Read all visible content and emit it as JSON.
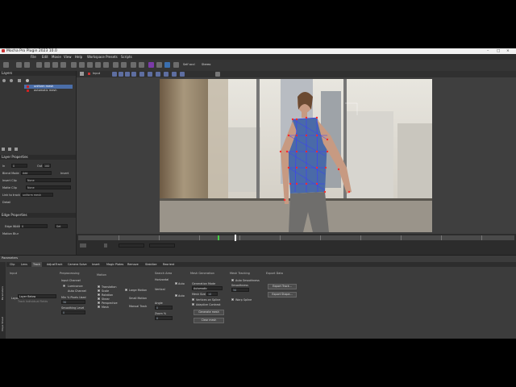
{
  "window": {
    "title": "Mocha Pro Plugin 2023 10.0"
  },
  "menu": [
    "File",
    "Edit",
    "Movie",
    "View",
    "Help",
    "Workspace Presets",
    "Scripts"
  ],
  "toolbar": {
    "layer_dropdown": "Input",
    "self_occlusion": "Self occl",
    "mode_dropdown": "Stereo"
  },
  "layers": {
    "header": "Layers",
    "items": [
      {
        "label": "uniform mesh",
        "color": "#cc2222"
      },
      {
        "label": "automatic mesh",
        "color": "#cc2222"
      }
    ]
  },
  "layer_properties": {
    "header": "Layer Properties",
    "rows": [
      {
        "label": "In",
        "value": "0"
      },
      {
        "label": "Blend Mode",
        "value": "Add"
      },
      {
        "label": "Insert Clip",
        "value": "None"
      },
      {
        "label": "Matte Clip",
        "value": "None"
      },
      {
        "label": "Link to track",
        "value": "uniform mesh"
      },
      {
        "label": "Detail",
        "value": ""
      }
    ],
    "out_label": "Out",
    "out_value": "100",
    "invert_label": "Invert"
  },
  "edge_properties": {
    "header": "Edge Properties",
    "edge_width_label": "Edge Width",
    "edge_width_value": "0",
    "set_label": "Set",
    "motion_blur_label": "Motion Blur"
  },
  "timeline": {
    "playhead_frame": "0",
    "track_label": "Track"
  },
  "tooltip": "Track Forwards (Ctrl+T)",
  "parameters": {
    "header": "Parameters",
    "tabs": [
      "Clip",
      "Lens",
      "Track",
      "AdjustTrack",
      "Camera Solve",
      "Insert",
      "Magic Plates",
      "Remove",
      "Stabilize",
      "Reorient"
    ],
    "active_tab": "Track",
    "side_tabs": [
      "Parameters",
      "Dope Sheet"
    ],
    "input": {
      "title": "Input",
      "layer_label": "Layer",
      "layer_value": "Layer Below",
      "preview": "Track Individual Fields"
    },
    "preprocessing": {
      "title": "Preprocessing",
      "input_channel": "Input Channel",
      "luminance": "Luminance",
      "auto_channel": "Auto Channel",
      "min_pixels": "Min % Pixels Used",
      "min_pixels_value": "30",
      "smoothing": "Smoothing Level",
      "smoothing_value": "0"
    },
    "motion": {
      "title": "Motion",
      "items": [
        "Translation",
        "Scale",
        "Rotation",
        "Shear",
        "Perspective",
        "Mesh"
      ],
      "large_motion": "Large Motion",
      "small_motion": "Small Motion",
      "manual_track": "Manual Track"
    },
    "search_area": {
      "title": "Search Area",
      "horizontal": "Horizontal",
      "vertical": "Vertical",
      "angle": "Angle",
      "angle_value": "0",
      "zoom": "Zoom %",
      "zoom_value": "0",
      "auto_h": "Auto",
      "auto_v": "Auto"
    },
    "mesh_generation": {
      "title": "Mesh Generation",
      "generation_mode": "Generation Mode",
      "mode_value": "Automatic",
      "mesh_size": "Mesh Size",
      "mesh_size_value": "10",
      "vertices_on_spline": "Vertices on Spline",
      "adaptive_contrast": "Adaptive Contrast",
      "generate": "Generate mesh",
      "clear": "Clear mesh"
    },
    "mesh_tracking": {
      "title": "Mesh Tracking",
      "auto_smoothness": "Auto Smoothness",
      "smoothness": "Smoothness",
      "smoothness_value": "50",
      "warp_spline": "Warp Spline"
    },
    "export_data": {
      "title": "Export Data",
      "export_tracking": "Export Track...",
      "export_shape": "Export Shape..."
    }
  }
}
